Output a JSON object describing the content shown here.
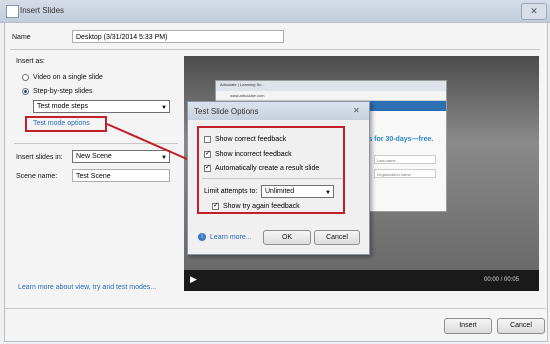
{
  "window": {
    "title": "Insert Slides",
    "close_glyph": "✕"
  },
  "name_label": "Name",
  "name_value": "Desktop (3/31/2014 5:33 PM)",
  "insert_as": {
    "label": "Insert as:",
    "options": [
      "Video on a single slide",
      "Step-by-step slides"
    ],
    "selected": "Step-by-step slides",
    "mode_value": "Test mode steps",
    "mode_options_link": "Test mode options"
  },
  "insert_in": {
    "label": "Insert slides in:",
    "value": "New Scene"
  },
  "scene_name": {
    "label": "Scene name:",
    "value": "Test Scene"
  },
  "learn_more_main": "Learn more about view, try and test modes...",
  "footer": {
    "insert": "Insert",
    "cancel": "Cancel"
  },
  "slide_preview": {
    "tab_text": "Articulate | Learning Sc...",
    "address": "www.articulate.com",
    "headline": "ts for 30-days—free.",
    "field1": "Last name",
    "field2": "Organization name"
  },
  "video": {
    "time": "00:00 / 00:05",
    "play_icon": "play-icon"
  },
  "test_slide_options": {
    "title": "Test Slide Options",
    "close_glyph": "✕",
    "show_correct": {
      "label": "Show correct feedback",
      "checked": false
    },
    "show_incorrect": {
      "label": "Show incorrect feedback",
      "checked": true
    },
    "auto_result": {
      "label": "Automatically create a result slide",
      "checked": true
    },
    "limit_label": "Limit attempts to:",
    "limit_value": "Unlimited",
    "try_again": {
      "label": "Show try again feedback",
      "checked": true
    },
    "learn_more": "Learn more...",
    "ok": "OK",
    "cancel": "Cancel"
  },
  "colors": {
    "annotation_red": "#c0202a",
    "link_blue": "#2a6bb8"
  }
}
